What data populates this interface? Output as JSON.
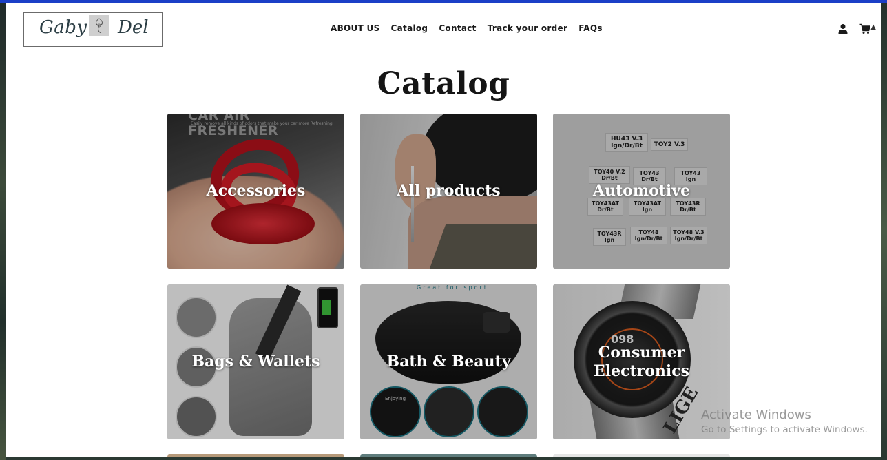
{
  "brand": {
    "logo_left": "Gaby",
    "logo_right": "Del"
  },
  "nav": {
    "items": [
      "ABOUT US",
      "Catalog",
      "Contact",
      "Track your order",
      "FAQs"
    ]
  },
  "header_icons": [
    "user-icon",
    "cart-icon"
  ],
  "page_title": "Catalog",
  "collections": [
    {
      "label": "Accessories",
      "image": "red spinning car air freshener on hand"
    },
    {
      "label": "All products",
      "image": "earring on woman's ear"
    },
    {
      "label": "Automotive",
      "image": "labeled key blank cases"
    },
    {
      "label": "Bags & Wallets",
      "image": "grey sling backpack"
    },
    {
      "label": "Bath & Beauty",
      "image": "black bluetooth headband"
    },
    {
      "label": "Consumer Electronics",
      "image": "smart watch"
    }
  ],
  "tile_image_text": {
    "accessories_banner": "CAR AIR FRESHENER",
    "accessories_sub": "Easily remove all kinds of odors that make your car more Refreshing",
    "bath_banner": "Great for sport",
    "bath_button": "Enjoying",
    "auto_labels": [
      "HU43 V.3 Ign/Dr/Bt",
      "TOY2 V.3",
      "TOY40 V.2 Dr/Bt",
      "TOY43 Dr/Bt",
      "TOY43 Ign",
      "TOY43AT Dr/Bt",
      "TOY43AT Ign",
      "TOY43R Dr/Bt",
      "TOY43R Ign",
      "TOY48 Ign/Dr/Bt",
      "TOY48 V.3 Ign/Dr/Bt"
    ],
    "watch_brand": "LIGE",
    "watch_reading": "098"
  },
  "os_watermark": {
    "line1": "Activate Windows",
    "line2": "Go to Settings to activate Windows."
  }
}
